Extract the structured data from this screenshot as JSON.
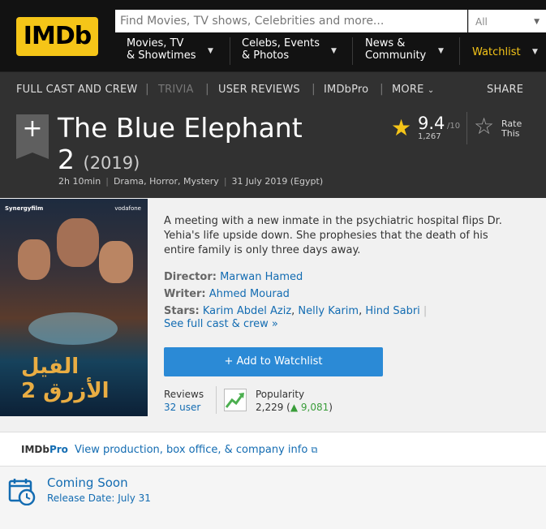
{
  "nav": {
    "logo": "IMDb",
    "search_placeholder": "Find Movies, TV shows, Celebrities and more...",
    "search_category": "All",
    "items": [
      {
        "line1": "Movies, TV",
        "line2": "& Showtimes"
      },
      {
        "line1": "Celebs, Events",
        "line2": "& Photos"
      },
      {
        "line1": "News &",
        "line2": "Community"
      }
    ],
    "watchlist": "Watchlist"
  },
  "subnav": {
    "full_cast": "FULL CAST AND CREW",
    "trivia": "TRIVIA",
    "user_reviews": "USER REVIEWS",
    "imdbpro": "IMDbPro",
    "more": "MORE",
    "share": "SHARE"
  },
  "title": {
    "name_line1": "The Blue Elephant",
    "name_line2": "2",
    "year": "(2019)",
    "runtime": "2h 10min",
    "genres": "Drama, Horror, Mystery",
    "release": "31 July 2019 (Egypt)",
    "rating": "9.4",
    "rating_max": "/10",
    "rating_count": "1,267",
    "rate_this_line1": "Rate",
    "rate_this_line2": "This"
  },
  "poster": {
    "studio": "Synergyfilm",
    "sponsor": "vodafone",
    "arabic_title": "الفيل الأزرق 2"
  },
  "overview": {
    "plot": "A meeting with a new inmate in the psychiatric hospital flips Dr. Yehia's life upside down. She prophesies that the death of his entire family is only three days away.",
    "director_label": "Director:",
    "director": "Marwan Hamed",
    "writer_label": "Writer:",
    "writer": "Ahmed Mourad",
    "stars_label": "Stars:",
    "stars": [
      "Karim Abdel Aziz",
      "Nelly Karim",
      "Hind Sabri"
    ],
    "see_all": "See full cast & crew »",
    "add_watchlist": "+ Add to Watchlist",
    "reviews_label": "Reviews",
    "reviews_link": "32 user",
    "popularity_label": "Popularity",
    "popularity_value": "2,229",
    "popularity_change": "9,081"
  },
  "pro": {
    "logo_a": "IMDb",
    "logo_b": "Pro",
    "link": "View production, box office, & company info"
  },
  "coming_soon": {
    "title": "Coming Soon",
    "date": "Release Date: July 31"
  },
  "colors": {
    "brand_yellow": "#f5c518",
    "dark_bg": "#313131",
    "link_blue": "#136cb2",
    "button_blue": "#2b8ad6"
  }
}
